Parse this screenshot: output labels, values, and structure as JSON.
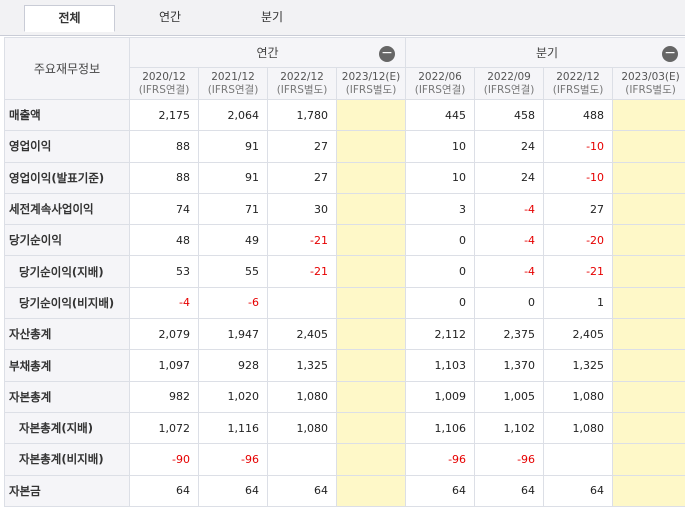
{
  "tabs": [
    {
      "label": "전체",
      "active": true
    },
    {
      "label": "연간",
      "active": false
    },
    {
      "label": "분기",
      "active": false
    }
  ],
  "header": {
    "corner": "주요재무정보",
    "annual_group": "연간",
    "quarter_group": "분기",
    "collapse_symbol": "−",
    "columns": [
      {
        "period": "2020/12",
        "basis": "(IFRS연결)"
      },
      {
        "period": "2021/12",
        "basis": "(IFRS연결)"
      },
      {
        "period": "2022/12",
        "basis": "(IFRS별도)"
      },
      {
        "period": "2023/12(E)",
        "basis": "(IFRS별도)"
      },
      {
        "period": "2022/06",
        "basis": "(IFRS연결)"
      },
      {
        "period": "2022/09",
        "basis": "(IFRS연결)"
      },
      {
        "period": "2022/12",
        "basis": "(IFRS별도)"
      },
      {
        "period": "2023/03(E)",
        "basis": "(IFRS별도)"
      }
    ]
  },
  "rows": [
    {
      "label": "매출액",
      "indent": false,
      "values": [
        "2,175",
        "2,064",
        "1,780",
        "",
        "445",
        "458",
        "488",
        ""
      ]
    },
    {
      "label": "영업이익",
      "indent": false,
      "values": [
        "88",
        "91",
        "27",
        "",
        "10",
        "24",
        "-10",
        ""
      ]
    },
    {
      "label": "영업이익(발표기준)",
      "indent": false,
      "values": [
        "88",
        "91",
        "27",
        "",
        "10",
        "24",
        "-10",
        ""
      ]
    },
    {
      "label": "세전계속사업이익",
      "indent": false,
      "values": [
        "74",
        "71",
        "30",
        "",
        "3",
        "-4",
        "27",
        ""
      ]
    },
    {
      "label": "당기순이익",
      "indent": false,
      "values": [
        "48",
        "49",
        "-21",
        "",
        "0",
        "-4",
        "-20",
        ""
      ]
    },
    {
      "label": "당기순이익(지배)",
      "indent": true,
      "values": [
        "53",
        "55",
        "-21",
        "",
        "0",
        "-4",
        "-21",
        ""
      ]
    },
    {
      "label": "당기순이익(비지배)",
      "indent": true,
      "values": [
        "-4",
        "-6",
        "",
        "",
        "0",
        "0",
        "1",
        ""
      ]
    },
    {
      "label": "자산총계",
      "indent": false,
      "values": [
        "2,079",
        "1,947",
        "2,405",
        "",
        "2,112",
        "2,375",
        "2,405",
        ""
      ]
    },
    {
      "label": "부채총계",
      "indent": false,
      "values": [
        "1,097",
        "928",
        "1,325",
        "",
        "1,103",
        "1,370",
        "1,325",
        ""
      ]
    },
    {
      "label": "자본총계",
      "indent": false,
      "values": [
        "982",
        "1,020",
        "1,080",
        "",
        "1,009",
        "1,005",
        "1,080",
        ""
      ]
    },
    {
      "label": "자본총계(지배)",
      "indent": true,
      "values": [
        "1,072",
        "1,116",
        "1,080",
        "",
        "1,106",
        "1,102",
        "1,080",
        ""
      ]
    },
    {
      "label": "자본총계(비지배)",
      "indent": true,
      "values": [
        "-90",
        "-96",
        "",
        "",
        "-96",
        "-96",
        "",
        ""
      ]
    },
    {
      "label": "자본금",
      "indent": false,
      "values": [
        "64",
        "64",
        "64",
        "",
        "64",
        "64",
        "64",
        ""
      ]
    }
  ],
  "colors": {
    "estimate_bg": "#fef8c8",
    "negative": "#e60000"
  }
}
